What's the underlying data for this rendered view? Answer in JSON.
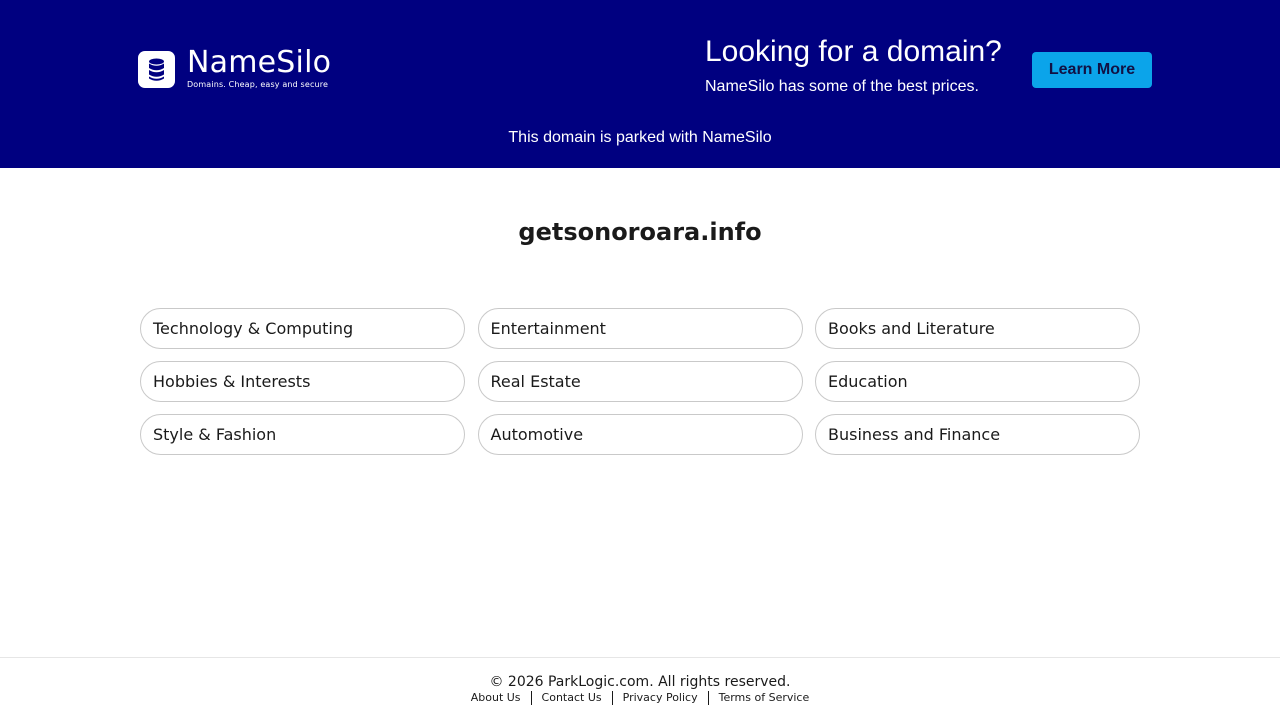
{
  "header": {
    "logo": {
      "name": "NameSilo",
      "tagline": "Domains. Cheap, easy and secure",
      "icon": "database-icon"
    },
    "promo_title": "Looking for a domain?",
    "promo_subtitle": "NameSilo has some of the best prices.",
    "learn_more_label": "Learn More",
    "parked_text": "This domain is parked with NameSilo"
  },
  "main": {
    "domain_name": "getsonoroara.info",
    "categories": [
      "Technology & Computing",
      "Entertainment",
      "Books and Literature",
      "Hobbies & Interests",
      "Real Estate",
      "Education",
      "Style & Fashion",
      "Automotive",
      "Business and Finance"
    ]
  },
  "footer": {
    "copyright": "© 2026 ParkLogic.com. All rights reserved.",
    "links": [
      "About Us",
      "Contact Us",
      "Privacy Policy",
      "Terms of Service"
    ]
  },
  "colors": {
    "banner_bg": "#000080",
    "button_bg": "#0ba4ea",
    "text": "#1a1a1a"
  }
}
